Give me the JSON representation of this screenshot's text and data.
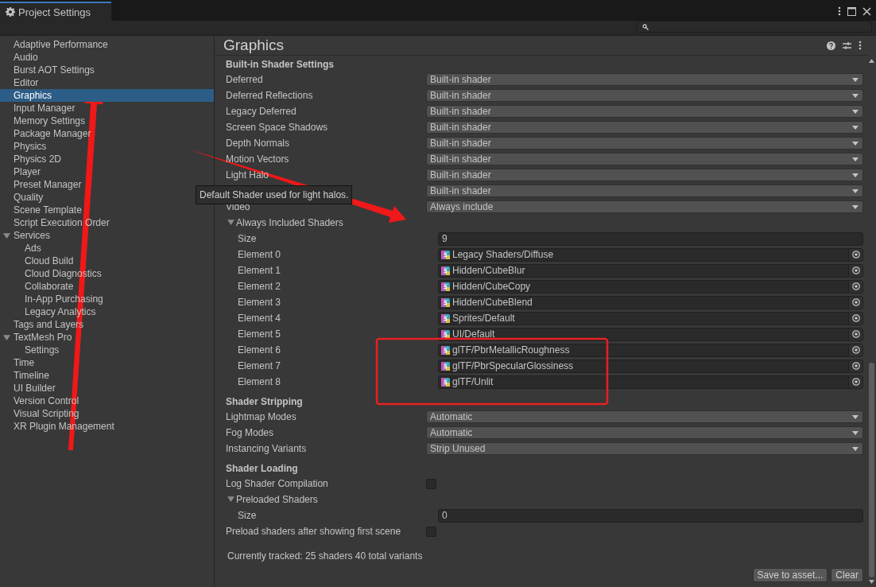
{
  "window": {
    "tab_title": "Project Settings"
  },
  "sidebar": {
    "items": [
      {
        "label": "Adaptive Performance",
        "selected": false
      },
      {
        "label": "Audio",
        "selected": false
      },
      {
        "label": "Burst AOT Settings",
        "selected": false
      },
      {
        "label": "Editor",
        "selected": false
      },
      {
        "label": "Graphics",
        "selected": true
      },
      {
        "label": "Input Manager",
        "selected": false
      },
      {
        "label": "Memory Settings",
        "selected": false
      },
      {
        "label": "Package Manager",
        "selected": false
      },
      {
        "label": "Physics",
        "selected": false
      },
      {
        "label": "Physics 2D",
        "selected": false
      },
      {
        "label": "Player",
        "selected": false
      },
      {
        "label": "Preset Manager",
        "selected": false
      },
      {
        "label": "Quality",
        "selected": false
      },
      {
        "label": "Scene Template",
        "selected": false
      },
      {
        "label": "Script Execution Order",
        "selected": false
      },
      {
        "label": "Services",
        "selected": false,
        "expanded": true,
        "children": [
          {
            "label": "Ads",
            "selected": false
          },
          {
            "label": "Cloud Build",
            "selected": false
          },
          {
            "label": "Cloud Diagnostics",
            "selected": false
          },
          {
            "label": "Collaborate",
            "selected": false
          },
          {
            "label": "In-App Purchasing",
            "selected": false
          },
          {
            "label": "Legacy Analytics",
            "selected": false
          }
        ]
      },
      {
        "label": "Tags and Layers",
        "selected": false
      },
      {
        "label": "TextMesh Pro",
        "selected": false,
        "expanded": true,
        "children": [
          {
            "label": "Settings",
            "selected": false
          }
        ]
      },
      {
        "label": "Time",
        "selected": false
      },
      {
        "label": "Timeline",
        "selected": false
      },
      {
        "label": "UI Builder",
        "selected": false
      },
      {
        "label": "Version Control",
        "selected": false
      },
      {
        "label": "Visual Scripting",
        "selected": false
      },
      {
        "label": "XR Plugin Management",
        "selected": false
      }
    ]
  },
  "panel": {
    "title": "Graphics",
    "sections": [
      {
        "title": "Built-in Shader Settings",
        "rows": [
          {
            "kind": "dropdown",
            "label": "Deferred",
            "value": "Built-in shader"
          },
          {
            "kind": "dropdown",
            "label": "Deferred Reflections",
            "value": "Built-in shader"
          },
          {
            "kind": "dropdown",
            "label": "Legacy Deferred",
            "value": "Built-in shader"
          },
          {
            "kind": "dropdown",
            "label": "Screen Space Shadows",
            "value": "Built-in shader"
          },
          {
            "kind": "dropdown",
            "label": "Depth Normals",
            "value": "Built-in shader"
          },
          {
            "kind": "dropdown",
            "label": "Motion Vectors",
            "value": "Built-in shader"
          },
          {
            "kind": "dropdown",
            "label": "Light Halo",
            "value": "Built-in shader"
          },
          {
            "kind": "dropdown",
            "value": "Built-in shader"
          },
          {
            "kind": "dropdown",
            "label": "Video",
            "value": "Always include"
          },
          {
            "kind": "foldout",
            "label": "Always Included Shaders",
            "expanded": true,
            "children": [
              {
                "kind": "field",
                "label": "Size",
                "value": "9"
              },
              {
                "kind": "object",
                "label": "Element 0",
                "value": "Legacy Shaders/Diffuse"
              },
              {
                "kind": "object",
                "label": "Element 1",
                "value": "Hidden/CubeBlur"
              },
              {
                "kind": "object",
                "label": "Element 2",
                "value": "Hidden/CubeCopy"
              },
              {
                "kind": "object",
                "label": "Element 3",
                "value": "Hidden/CubeBlend"
              },
              {
                "kind": "object",
                "label": "Element 4",
                "value": "Sprites/Default"
              },
              {
                "kind": "object",
                "label": "Element 5",
                "value": "UI/Default"
              },
              {
                "kind": "object",
                "label": "Element 6",
                "value": "glTF/PbrMetallicRoughness"
              },
              {
                "kind": "object",
                "label": "Element 7",
                "value": "glTF/PbrSpecularGlossiness"
              },
              {
                "kind": "object",
                "label": "Element 8",
                "value": "glTF/Unlit"
              }
            ]
          }
        ]
      },
      {
        "title": "Shader Stripping",
        "rows": [
          {
            "kind": "dropdown",
            "label": "Lightmap Modes",
            "value": "Automatic"
          },
          {
            "kind": "dropdown",
            "label": "Fog Modes",
            "value": "Automatic"
          },
          {
            "kind": "dropdown",
            "label": "Instancing Variants",
            "value": "Strip Unused"
          }
        ]
      },
      {
        "title": "Shader Loading",
        "rows": [
          {
            "kind": "checkbox",
            "label": "Log Shader Compilation",
            "checked": false
          },
          {
            "kind": "foldout",
            "label": "Preloaded Shaders",
            "expanded": true,
            "children": [
              {
                "kind": "field",
                "label": "Size",
                "value": "0"
              }
            ]
          },
          {
            "kind": "checkbox",
            "label": "Preload shaders after showing first scene",
            "checked": false
          }
        ]
      }
    ],
    "status": "Currently tracked: 25 shaders 40 total variants",
    "buttons": [
      "Save to asset...",
      "Clear"
    ]
  },
  "tooltip": "Default Shader used for light halos."
}
